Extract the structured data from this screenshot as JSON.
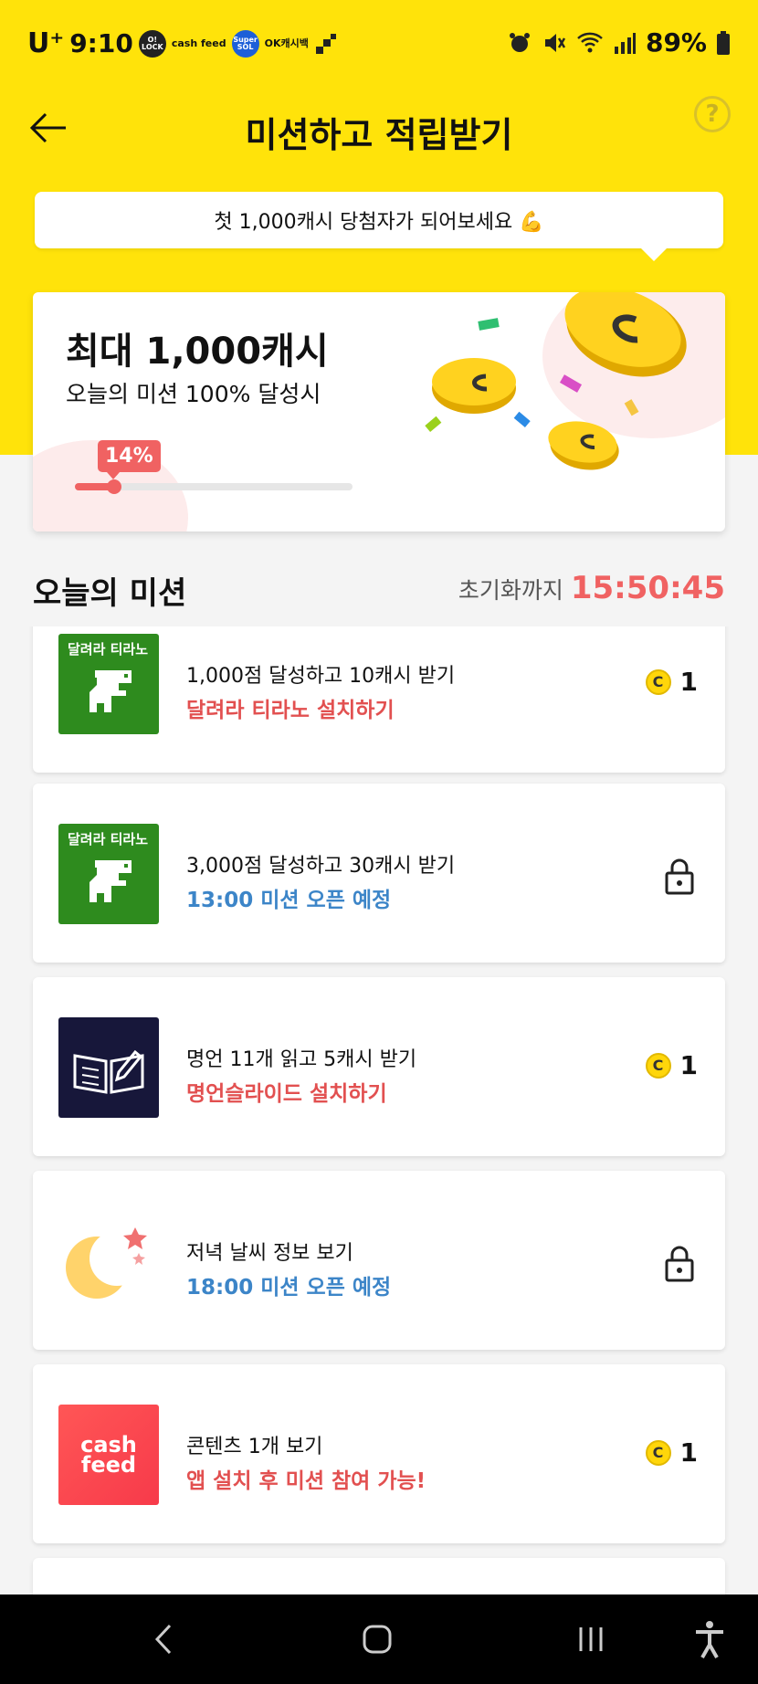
{
  "status_bar": {
    "carrier": "U⁺",
    "time": "9:10",
    "apps": [
      "O! LOCK",
      "cash feed",
      "Super SOL",
      "OK캐시백"
    ],
    "battery": "89%"
  },
  "header": {
    "title": "미션하고 적립받기"
  },
  "tooltip": {
    "text": "첫 1,000캐시 당첨자가 되어보세요 💪"
  },
  "reward_card": {
    "title": "최대 1,000캐시",
    "subtitle": "오늘의 미션 100% 달성시",
    "progress_label": "14%",
    "progress": 0.14
  },
  "section": {
    "title": "오늘의 미션",
    "reset_label": "초기화까지",
    "reset_time": "15:50:45"
  },
  "missions": [
    {
      "thumb_text": "달려라 티라노",
      "title": "1,000점 달성하고 10캐시 받기",
      "subtitle": "달려라 티라노 설치하기",
      "reward": "1",
      "locked": false
    },
    {
      "thumb_text": "달려라 티라노",
      "title": "3,000점 달성하고 30캐시 받기",
      "subtitle": "13:00 미션 오픈 예정",
      "locked": true
    },
    {
      "title": "명언 11개 읽고 5캐시 받기",
      "subtitle": "명언슬라이드 설치하기",
      "reward": "1",
      "locked": false
    },
    {
      "title": "저녁 날씨 정보 보기",
      "subtitle": "18:00 미션 오픈 예정",
      "locked": true
    },
    {
      "thumb_text": "cash feed",
      "title": "콘텐츠 1개 보기",
      "subtitle": "앱 설치 후 미션 참여 가능!",
      "reward": "1",
      "locked": false
    }
  ],
  "coin_symbol": "C",
  "colors": {
    "brand_yellow": "#ffe30a",
    "accent_red": "#f06262",
    "accent_blue": "#3c85c8"
  }
}
